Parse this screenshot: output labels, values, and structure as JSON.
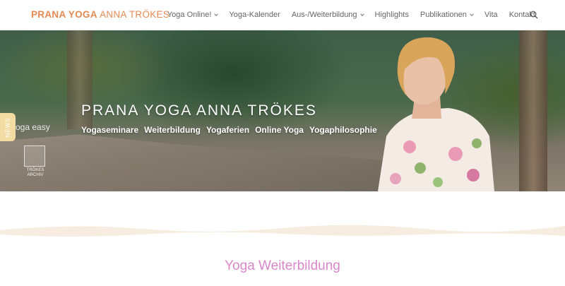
{
  "header": {
    "logo_bold": "PRANA YOGA",
    "logo_rest": "ANNA TRÖKES",
    "nav": [
      {
        "label": "Yoga Online!",
        "dropdown": true
      },
      {
        "label": "Yoga-Kalender",
        "dropdown": false
      },
      {
        "label": "Aus-/Weiterbildung",
        "dropdown": true
      },
      {
        "label": "Highlights",
        "dropdown": false
      },
      {
        "label": "Publikationen",
        "dropdown": true
      },
      {
        "label": "Vita",
        "dropdown": false
      },
      {
        "label": "Kontakt",
        "dropdown": false
      }
    ],
    "search_icon": "search-icon"
  },
  "hero": {
    "title": "PRANA YOGA ANNA TRÖKES",
    "links": [
      "Yogaseminare",
      "Weiterbildung",
      "Yogaferien",
      "Online Yoga",
      "Yogaphilosophie"
    ],
    "news_tab": "NEWS",
    "yogaeasy_label": "oga easy",
    "archiv_label_1": "TRÖKES",
    "archiv_label_2": "ARCHIV"
  },
  "section": {
    "title": "Yoga Weiterbildung"
  },
  "colors": {
    "logo": "#e58a52",
    "section_title": "#d987c9",
    "news_tab": "#f2dca3",
    "wave": "#f6ecdf"
  }
}
